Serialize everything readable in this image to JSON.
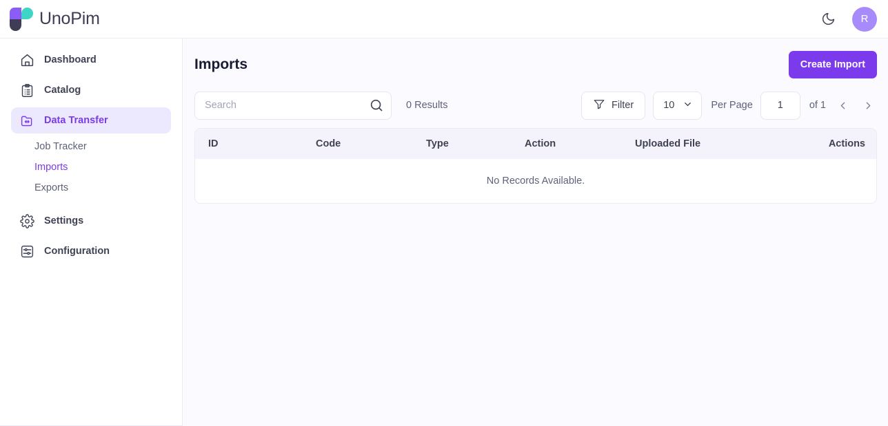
{
  "header": {
    "brand_name": "UnoPim",
    "theme_toggle_icon": "moon-icon",
    "avatar_initial": "R"
  },
  "sidebar": {
    "items": [
      {
        "label": "Dashboard",
        "icon": "home-icon",
        "active": false
      },
      {
        "label": "Catalog",
        "icon": "clipboard-list-icon",
        "active": false
      },
      {
        "label": "Data Transfer",
        "icon": "folder-exchange-icon",
        "active": true
      },
      {
        "label": "Settings",
        "icon": "gear-icon",
        "active": false
      },
      {
        "label": "Configuration",
        "icon": "sliders-icon",
        "active": false
      }
    ],
    "sub_items": [
      {
        "label": "Job Tracker",
        "active": false
      },
      {
        "label": "Imports",
        "active": true
      },
      {
        "label": "Exports",
        "active": false
      }
    ]
  },
  "page": {
    "title": "Imports",
    "create_button": "Create Import"
  },
  "toolbar": {
    "search_placeholder": "Search",
    "search_value": "",
    "search_icon": "search-icon",
    "results_text": "0 Results",
    "filter_label": "Filter",
    "filter_icon": "funnel-icon",
    "per_page_value": "10",
    "per_page_label": "Per Page",
    "page_value": "1",
    "total_pages_text": "of 1",
    "prev_icon": "chevron-left-icon",
    "next_icon": "chevron-right-icon"
  },
  "table": {
    "columns": [
      "ID",
      "Code",
      "Type",
      "Action",
      "Uploaded File",
      "Actions"
    ],
    "rows": [],
    "empty_message": "No Records Available."
  },
  "colors": {
    "accent": "#7c3aed",
    "accent_soft": "#ece9fe",
    "avatar": "#a78bfa",
    "logo_purple": "#8b5cf6",
    "logo_teal": "#3dd6c4",
    "logo_navy": "#3f3d56",
    "page_bg": "#fafaff",
    "table_header_bg": "#f4f3fc"
  }
}
